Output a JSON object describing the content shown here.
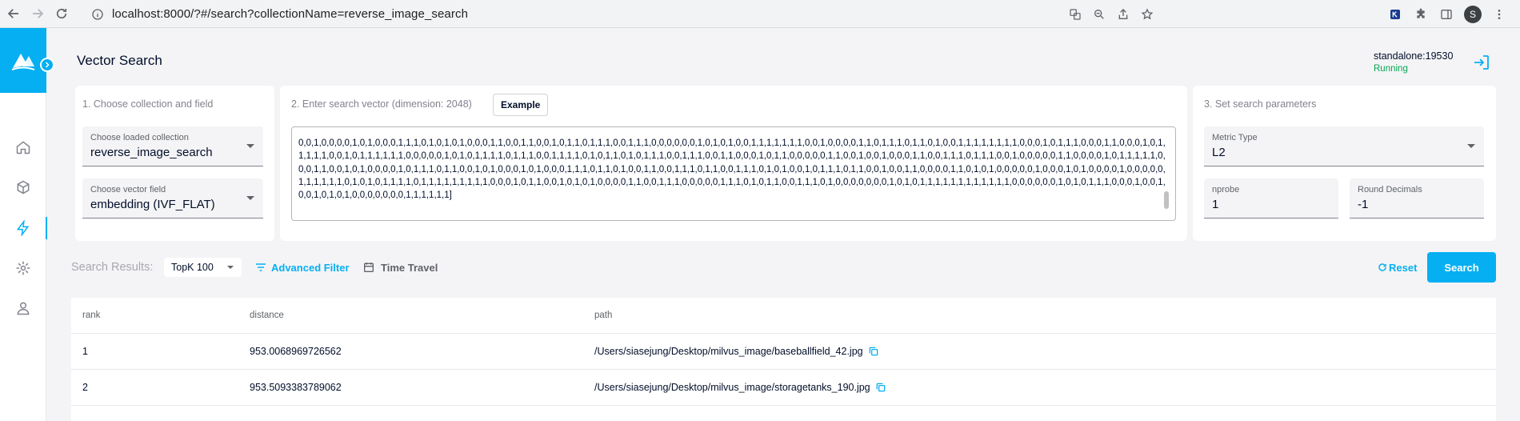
{
  "browser": {
    "url": "localhost:8000/?#/search?collectionName=reverse_image_search",
    "profile_initial": "S"
  },
  "header": {
    "title": "Vector Search",
    "server": "standalone:19530",
    "status": "Running"
  },
  "step1": {
    "title": "1. Choose collection and field",
    "collection_label": "Choose loaded collection",
    "collection_value": "reverse_image_search",
    "field_label": "Choose vector field",
    "field_value": "embedding (IVF_FLAT)"
  },
  "step2": {
    "title": "2. Enter search vector (dimension: 2048)",
    "example_label": "Example",
    "vector_text": "0,0,1,0,0,0,0,1,0,1,0,0,0,1,1,1,0,1,0,1,0,1,0,0,0,1,1,0,0,1,1,0,0,1,0,1,1,0,1,1,1,0,0,1,1,1,0,0,0,0,0,0,1,0,1,0,1,0,0,1,1,1,1,1,1,1,0,0,1,0,0,0,0,1,1,0,1,1,1,0,1,1,0,1,0,0,1,1,1,1,1,1,1,1,0,0,0,1,0,1,1,1,0,0,0,1,1,0,0,0,1,0,1,1,1,1,1,0,0,1,0,1,1,1,1,1,1,0,0,0,0,0,1,0,1,0,1,1,1,1,0,1,1,1,0,0,1,1,1,1,0,1,0,1,1,0,1,0,1,1,1,0,0,1,1,1,0,0,1,1,0,0,0,1,0,1,1,0,0,0,0,0,1,1,0,0,1,0,0,1,0,0,0,1,1,0,0,1,1,1,0,1,1,1,0,0,1,0,0,0,0,0,1,1,0,0,0,0,1,0,1,1,1,1,1,0,0,0,1,1,0,0,1,0,1,0,0,0,0,1,0,1,1,1,0,1,1,0,0,1,0,1,0,0,0,1,0,1,0,0,0,1,1,1,0,1,1,0,1,0,0,1,1,0,0,1,1,1,0,1,1,0,0,1,1,1,0,1,0,1,0,0,1,0,1,1,1,0,1,1,0,0,1,0,0,1,1,0,0,0,0,1,1,0,1,0,1,0,0,0,0,0,1,0,0,0,1,0,1,0,0,0,0,1,0,0,0,0,0,1,1,1,1,1,1,0,1,0,1,0,1,1,1,1,0,1,1,1,1,1,1,1,1,1,0,0,0,1,0,1,1,0,0,1,0,1,0,1,0,0,0,0,1,1,0,0,1,1,1,0,0,0,0,0,1,1,1,0,1,0,1,1,0,0,1,1,1,0,1,0,0,0,0,0,0,0,1,0,1,0,1,1,1,1,1,1,1,1,1,1,1,1,0,0,0,0,0,0,1,0,1,0,1,1,1,0,0,0,1,0,0,1,0,0,1,0,1,0,1,0,0,0,0,0,0,0,1,1,1,1,1,1]"
  },
  "step3": {
    "title": "3. Set search parameters",
    "metric_label": "Metric Type",
    "metric_value": "L2",
    "nprobe_label": "nprobe",
    "nprobe_value": "1",
    "round_label": "Round Decimals",
    "round_value": "-1"
  },
  "toolbar": {
    "results_label": "Search Results:",
    "topk_value": "TopK 100",
    "advanced_filter": "Advanced Filter",
    "time_travel": "Time Travel",
    "reset": "Reset",
    "search": "Search"
  },
  "table": {
    "columns": [
      "rank",
      "distance",
      "path"
    ],
    "rows": [
      {
        "rank": "1",
        "distance": "953.0068969726562",
        "path": "/Users/siasejung/Desktop/milvus_image/baseballfield_42.jpg"
      },
      {
        "rank": "2",
        "distance": "953.5093383789062",
        "path": "/Users/siasejung/Desktop/milvus_image/storagetanks_190.jpg"
      }
    ]
  },
  "colors": {
    "accent": "#06aff2",
    "running": "#07a452",
    "text": "#010e29",
    "background": "#f4f4f6"
  }
}
